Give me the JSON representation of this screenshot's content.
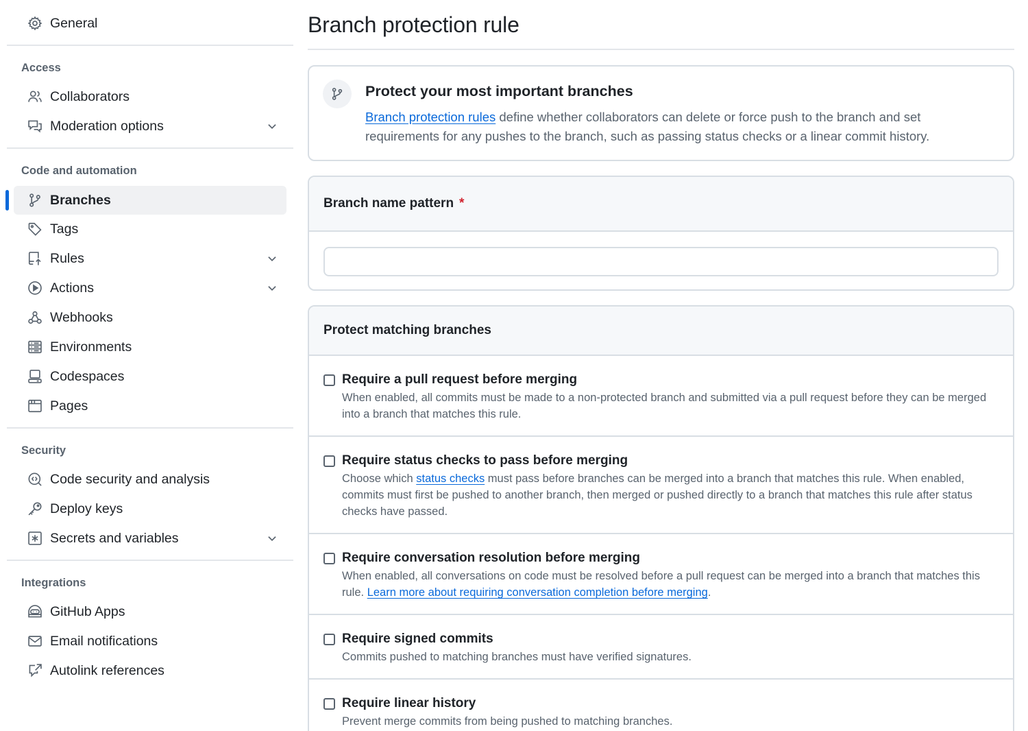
{
  "sidebar": {
    "general": "General",
    "groups": {
      "access": "Access",
      "code_automation": "Code and automation",
      "security": "Security",
      "integrations": "Integrations"
    },
    "items": {
      "collaborators": "Collaborators",
      "moderation": "Moderation options",
      "branches": "Branches",
      "tags": "Tags",
      "rules": "Rules",
      "actions": "Actions",
      "webhooks": "Webhooks",
      "environments": "Environments",
      "codespaces": "Codespaces",
      "pages": "Pages",
      "code_security": "Code security and analysis",
      "deploy_keys": "Deploy keys",
      "secrets": "Secrets and variables",
      "github_apps": "GitHub Apps",
      "email_notifications": "Email notifications",
      "autolink": "Autolink references"
    },
    "active_item": "Branches"
  },
  "main": {
    "title": "Branch protection rule",
    "intro": {
      "title": "Protect your most important branches",
      "link": "Branch protection rules",
      "text": " define whether collaborators can delete or force push to the branch and set requirements for any pushes to the branch, such as passing status checks or a linear commit history."
    },
    "pattern": {
      "label": "Branch name pattern",
      "required_mark": "*",
      "value": ""
    },
    "protect": {
      "header": "Protect matching branches",
      "rules": [
        {
          "title": "Require a pull request before merging",
          "desc": "When enabled, all commits must be made to a non-protected branch and submitted via a pull request before they can be merged into a branch that matches this rule."
        },
        {
          "title": "Require status checks to pass before merging",
          "desc_pre": "Choose which ",
          "desc_link": "status checks",
          "desc_post": " must pass before branches can be merged into a branch that matches this rule. When enabled, commits must first be pushed to another branch, then merged or pushed directly to a branch that matches this rule after status checks have passed."
        },
        {
          "title": "Require conversation resolution before merging",
          "desc_pre": "When enabled, all conversations on code must be resolved before a pull request can be merged into a branch that matches this rule. ",
          "desc_link": "Learn more about requiring conversation completion before merging",
          "desc_post": "."
        },
        {
          "title": "Require signed commits",
          "desc": "Commits pushed to matching branches must have verified signatures."
        },
        {
          "title": "Require linear history",
          "desc": "Prevent merge commits from being pushed to matching branches."
        }
      ]
    }
  },
  "colors": {
    "accent": "#0969da",
    "required": "#d1242f",
    "muted_text": "#59636e",
    "border": "#d8dee4",
    "header_bg": "#f6f8fa"
  }
}
